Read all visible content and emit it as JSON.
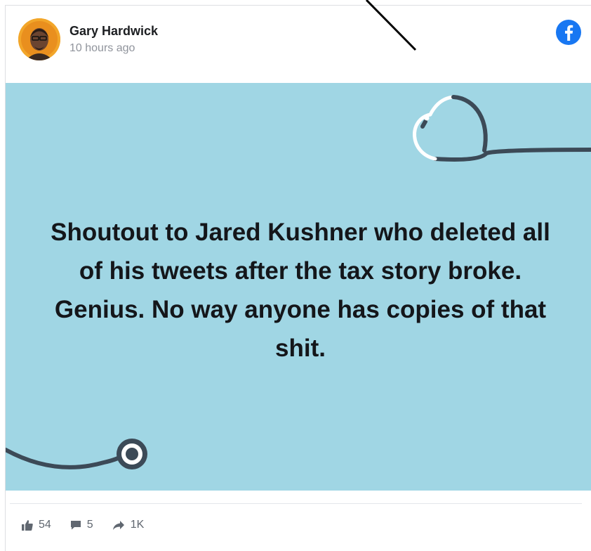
{
  "post": {
    "author": "Gary Hardwick",
    "timestamp": "10 hours ago",
    "text": "Shoutout to Jared Kushner who deleted all of his tweets after the tax story broke. Genius. No way anyone has copies of that shit."
  },
  "stats": {
    "likes": "54",
    "comments": "5",
    "shares": "1K"
  },
  "icons": {
    "platform": "facebook-logo-icon",
    "like": "thumbs-up-icon",
    "comment": "comment-icon",
    "share": "share-arrow-icon"
  },
  "colors": {
    "image_background": "#a0d6e4",
    "facebook_blue": "#1877f2",
    "text": "#14161a",
    "meta_gray": "#606770"
  }
}
